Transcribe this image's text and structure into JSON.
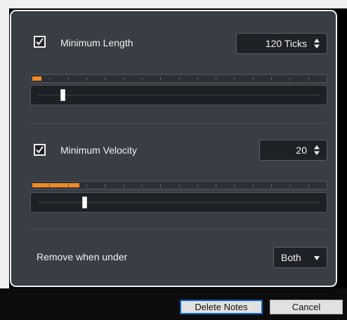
{
  "length": {
    "checkbox_checked": true,
    "label": "Minimum Length",
    "value": "120 Ticks",
    "meter_level": 0.03,
    "slider_position": 0.08
  },
  "velocity": {
    "checkbox_checked": true,
    "label": "Minimum Velocity",
    "value": "20",
    "meter_level": 0.16,
    "slider_position": 0.16
  },
  "remove": {
    "label": "Remove when under",
    "selected": "Both"
  },
  "buttons": {
    "delete": "Delete Notes",
    "cancel": "Cancel"
  },
  "colors": {
    "accent": "#f08a24",
    "panel": "#383e43",
    "default_button_border": "#0a64c8"
  },
  "icons": {
    "checkbox": "checkmark-icon",
    "spinner": "up-down-arrows-icon",
    "dropdown": "triangle-down-icon"
  }
}
